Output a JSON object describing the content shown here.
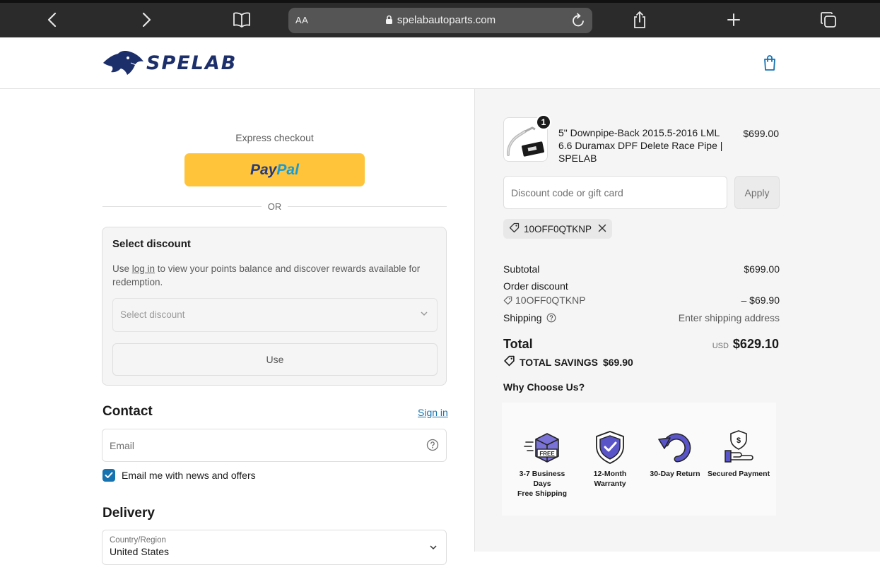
{
  "browser": {
    "text_size_label": "AA",
    "url": "spelabautoparts.com"
  },
  "header": {
    "brand": "SPELAB"
  },
  "express": {
    "title": "Express checkout",
    "paypal_part1": "Pay",
    "paypal_part2": "Pal",
    "or_label": "OR"
  },
  "select_discount": {
    "title": "Select discount",
    "text_before": "Use ",
    "login_link": "log in",
    "text_after": " to view your points balance and discover rewards available for redemption.",
    "placeholder": "Select discount",
    "use_label": "Use"
  },
  "contact": {
    "title": "Contact",
    "sign_in": "Sign in",
    "email_placeholder": "Email",
    "news_label": "Email me with news and offers"
  },
  "delivery": {
    "title": "Delivery",
    "country_label": "Country/Region",
    "country_value": "United States"
  },
  "order": {
    "quantity": "1",
    "product_name": "5\" Downpipe-Back 2015.5-2016 LML 6.6 Duramax DPF Delete Race Pipe | SPELAB",
    "product_price": "$699.00",
    "discount_placeholder": "Discount code or gift card",
    "apply_label": "Apply",
    "applied_code": "10OFF0QTKNP",
    "subtotal_label": "Subtotal",
    "subtotal_value": "$699.00",
    "order_discount_label": "Order discount",
    "discount_code": "10OFF0QTKNP",
    "discount_value": "– $69.90",
    "shipping_label": "Shipping",
    "shipping_value": "Enter shipping address",
    "total_label": "Total",
    "currency": "USD",
    "total_value": "$629.10",
    "savings_label": "TOTAL SAVINGS",
    "savings_value": "$69.90"
  },
  "why": {
    "title": "Why Choose Us?",
    "features": [
      {
        "line1": "3-7 Business Days",
        "line2": "Free Shipping",
        "icon": "free-shipping-box-icon"
      },
      {
        "line1": "12-Month Warranty",
        "line2": "",
        "icon": "shield-check-icon"
      },
      {
        "line1": "30-Day Return",
        "line2": "",
        "icon": "return-arrow-icon"
      },
      {
        "line1": "Secured Payment",
        "line2": "",
        "icon": "secure-payment-icon"
      }
    ]
  },
  "colors": {
    "browser_bar": "#2b2b2b",
    "brand_navy": "#1c2f6b",
    "paypal_yellow": "#ffc439",
    "link_blue": "#1773b0",
    "summary_bg": "#f5f5f5",
    "feature_purple": "#5a54c9"
  }
}
